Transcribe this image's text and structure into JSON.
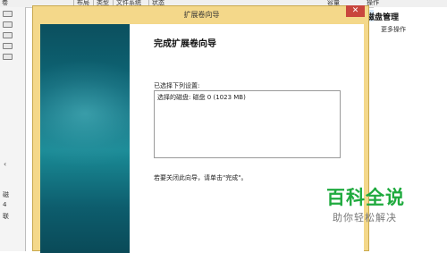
{
  "background": {
    "columns": [
      "卷",
      "布局",
      "类型",
      "文件系统",
      "状态",
      "容量",
      "操作"
    ],
    "right_panel_title": "磁盘管理",
    "right_panel_more": "更多操作",
    "left_strip_chars": [
      "磁",
      "4",
      "联"
    ]
  },
  "dialog": {
    "title": "扩展卷向导",
    "close_glyph": "✕",
    "heading": "完成扩展卷向导",
    "selected_settings_label": "已选择下列设置:",
    "settings_list": [
      "选择的磁盘: 磁盘 0 (1023 MB)"
    ],
    "finish_instruction": "若要关闭此向导，请单击\"完成\"。"
  },
  "watermark": {
    "main": "百科全说",
    "sub": "助你轻松解决"
  }
}
